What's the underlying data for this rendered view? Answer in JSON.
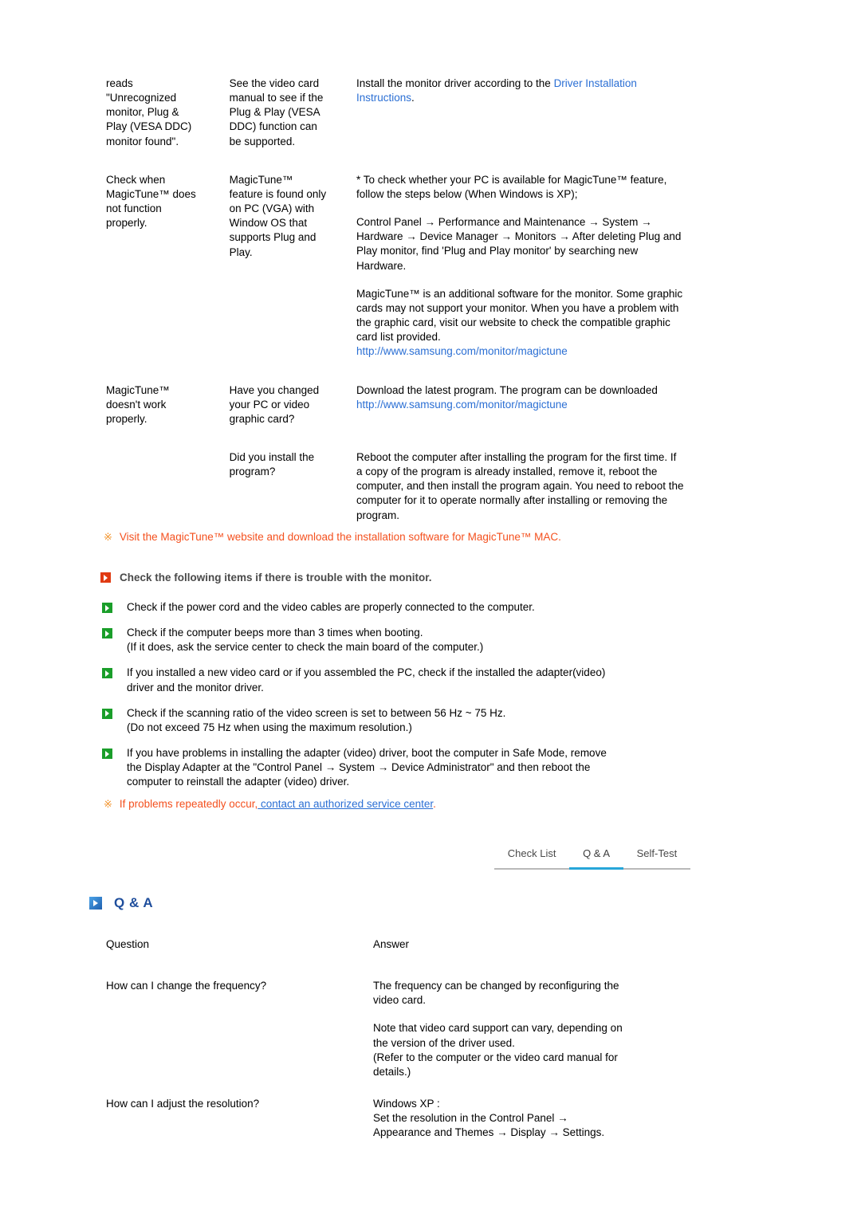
{
  "trouble_table": {
    "rows": [
      {
        "symptom": [
          "reads",
          "\"Unrecognized",
          "monitor, Plug &",
          "Play (VESA DDC)",
          "monitor found\"."
        ],
        "checklist": [
          "See the video card",
          "manual to see if the",
          "Plug & Play (VESA",
          "DDC) function can",
          "be supported."
        ],
        "solutions": [
          {
            "segments": [
              {
                "text": "Install the monitor driver according to the ",
                "style": "plain"
              },
              {
                "text": "Driver Installation Instructions",
                "style": "link"
              },
              {
                "text": ".",
                "style": "plain"
              }
            ]
          }
        ]
      },
      {
        "symptom": [
          "Check when",
          "MagicTune™ does",
          "not function",
          "properly."
        ],
        "checklist": [
          "MagicTune™",
          "feature is found only",
          "on PC (VGA) with",
          "Window OS that",
          "supports Plug and",
          "Play."
        ],
        "solutions": [
          {
            "segments": [
              {
                "text": "* To check whether your PC is available for MagicTune™ feature, follow the steps below (When Windows is XP);",
                "style": "plain"
              }
            ]
          },
          {
            "segments": [
              {
                "text": "Control Panel → Performance and Maintenance → System → Hardware → Device Manager → Monitors → After deleting Plug and Play monitor, find 'Plug and Play monitor' by searching new Hardware.",
                "style": "plain"
              }
            ]
          },
          {
            "segments": [
              {
                "text": "MagicTune™ is an additional software for the monitor. Some graphic cards may not support your monitor. When you have a problem with the graphic card, visit our website to check the compatible graphic card list provided.",
                "style": "plain"
              },
              {
                "text": "http://www.samsung.com/monitor/magictune",
                "style": "link-block"
              }
            ]
          }
        ]
      },
      {
        "symptom": [
          "MagicTune™",
          "doesn't work",
          "properly."
        ],
        "checklist": [
          "Have you changed",
          "your PC or video",
          "graphic card?"
        ],
        "solutions": [
          {
            "segments": [
              {
                "text": "Download the latest program. The program can be downloaded ",
                "style": "plain"
              },
              {
                "text": "http://www.samsung.com/monitor/magictune",
                "style": "link"
              }
            ]
          }
        ]
      },
      {
        "symptom": [],
        "checklist": [
          "Did you install the",
          "program?"
        ],
        "solutions": [
          {
            "segments": [
              {
                "text": "Reboot the computer after installing the program for the first time. If a copy of the program is already installed, remove it, reboot the computer, and then install the program again. You need to reboot the computer for it to operate normally after installing or removing the program.",
                "style": "plain"
              }
            ]
          }
        ]
      }
    ]
  },
  "notices": {
    "magictune_mac": {
      "mark": "※",
      "text": "Visit the MagicTune™ website and download the installation software for MagicTune™ MAC."
    },
    "service_center": {
      "mark": "※",
      "lead": "If problems repeatedly occur,",
      "link": " contact an authorized service center",
      "tail": "."
    }
  },
  "section_header": {
    "icon": "red-play-bullet",
    "text": "Check the following items if there is trouble with the monitor."
  },
  "checklist": {
    "icon": "green-play-bullet",
    "items": [
      [
        "Check if the power cord and the video cables are properly connected to the computer."
      ],
      [
        "Check if the computer beeps more than 3 times when booting.",
        "(If it does, ask the service center to check the main board of the computer.)"
      ],
      [
        "If you installed a new video card or if you assembled the PC, check if the installed the adapter(video)",
        "driver and the monitor driver."
      ],
      [
        "Check if the scanning ratio of the video screen is set to between 56 Hz ~ 75 Hz.",
        "(Do not exceed 75 Hz when using the maximum resolution.)"
      ],
      [
        "If you have problems in installing the adapter (video) driver, boot the computer in Safe Mode, remove",
        "the Display Adapter at the \"Control Panel → System → Device Administrator\" and then reboot the",
        "computer to reinstall the adapter (video) driver."
      ]
    ]
  },
  "tabs": {
    "items": [
      {
        "label": "Check List",
        "active": false
      },
      {
        "label": "Q & A",
        "active": true
      },
      {
        "label": "Self-Test",
        "active": false
      }
    ],
    "active_color": "#27a6d9"
  },
  "qa_section": {
    "icon": "blue-play-bullet",
    "title": "Q & A",
    "headers": {
      "question": "Question",
      "answer": "Answer"
    },
    "rows": [
      {
        "question": "How can I change the frequency?",
        "answer": [
          [
            "The frequency can be changed by reconfiguring the",
            "video card."
          ],
          [
            "Note that video card support can vary, depending on",
            "the version of the driver used.",
            "(Refer to the computer or the video card manual for",
            "details.)"
          ]
        ]
      },
      {
        "question": "How can I adjust the resolution?",
        "answer": [
          [
            "Windows XP :",
            "Set the resolution in the Control Panel →",
            "Appearance and Themes → Display → Settings."
          ]
        ]
      }
    ]
  },
  "colors": {
    "link": "#2b6fd4",
    "notice": "#f4501e",
    "mark": "#f2922a",
    "bullet_red": "#e03a12",
    "bullet_green": "#1a9e2a",
    "tab_active": "#27a6d9",
    "qa_title": "#1f4e9c"
  }
}
